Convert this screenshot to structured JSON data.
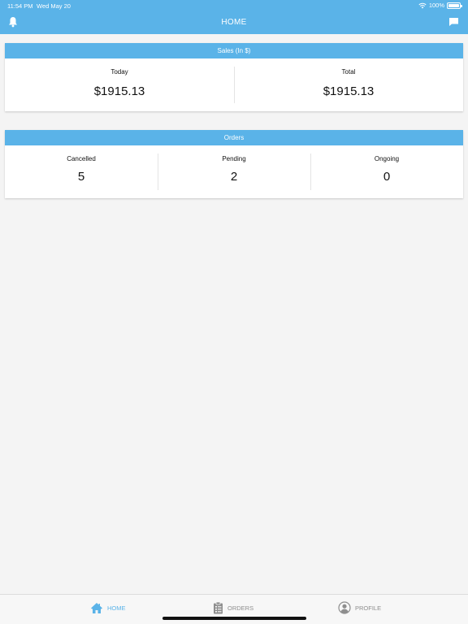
{
  "status_bar": {
    "time": "11:54 PM",
    "date": "Wed May 20",
    "battery_pct": "100%"
  },
  "nav": {
    "title": "HOME",
    "left_icon": "bell-icon",
    "right_icon": "chat-icon"
  },
  "sales": {
    "title": "Sales (In $)",
    "today_label": "Today",
    "today_value": "$1915.13",
    "total_label": "Total",
    "total_value": "$1915.13"
  },
  "orders": {
    "title": "Orders",
    "cancelled_label": "Cancelled",
    "cancelled_value": "5",
    "pending_label": "Pending",
    "pending_value": "2",
    "ongoing_label": "Ongoing",
    "ongoing_value": "0"
  },
  "tabs": [
    {
      "label": "HOME",
      "icon": "home-icon",
      "active": true
    },
    {
      "label": "ORDERS",
      "icon": "clipboard-icon",
      "active": false
    },
    {
      "label": "PROFILE",
      "icon": "user-icon",
      "active": false
    }
  ],
  "colors": {
    "accent": "#5ab3e8",
    "background": "#f4f4f4",
    "inactive_tab": "#8e8e8e"
  }
}
